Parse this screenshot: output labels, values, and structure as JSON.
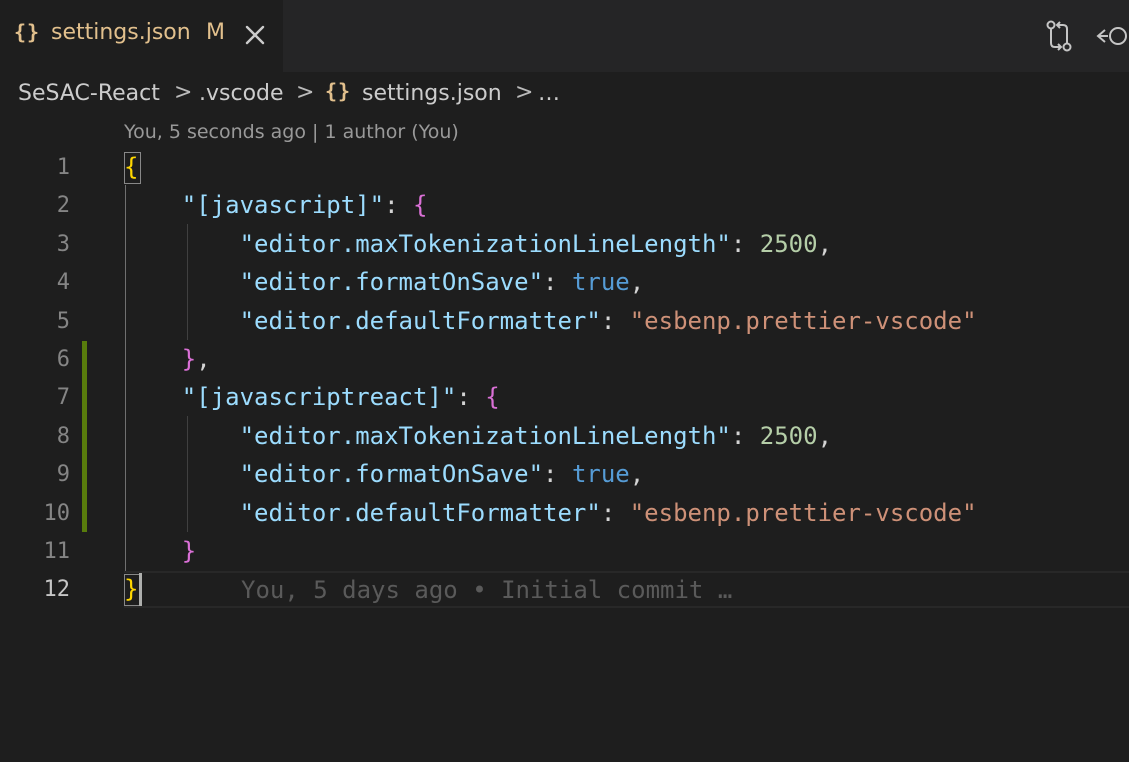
{
  "tab": {
    "icon_text": "{}",
    "label": "settings.json",
    "modified_badge": "M",
    "close_icon": "close-icon"
  },
  "editor_actions": {
    "compare_icon": "git-compare-icon",
    "back_icon": "go-back-icon"
  },
  "breadcrumb": {
    "items": [
      "SeSAC-React",
      ".vscode",
      "settings.json",
      "…"
    ],
    "file_icon_text": "{}",
    "separator": ">"
  },
  "codelens": "You, 5 seconds ago | 1 author (You)",
  "gutter": {
    "line_numbers": [
      "1",
      "2",
      "3",
      "4",
      "5",
      "6",
      "7",
      "8",
      "9",
      "10",
      "11",
      "12"
    ],
    "active_line": "12"
  },
  "code": {
    "lines": [
      {
        "tokens": [
          {
            "c": "y",
            "t": "{"
          }
        ]
      },
      {
        "tokens": [
          {
            "c": "p",
            "t": "    "
          },
          {
            "c": "k",
            "t": "\"[javascript]\""
          },
          {
            "c": "p",
            "t": ": "
          },
          {
            "c": "m",
            "t": "{"
          }
        ]
      },
      {
        "tokens": [
          {
            "c": "p",
            "t": "        "
          },
          {
            "c": "k",
            "t": "\"editor.maxTokenizationLineLength\""
          },
          {
            "c": "p",
            "t": ": "
          },
          {
            "c": "n",
            "t": "2500"
          },
          {
            "c": "p",
            "t": ","
          }
        ]
      },
      {
        "tokens": [
          {
            "c": "p",
            "t": "        "
          },
          {
            "c": "k",
            "t": "\"editor.formatOnSave\""
          },
          {
            "c": "p",
            "t": ": "
          },
          {
            "c": "b",
            "t": "true"
          },
          {
            "c": "p",
            "t": ","
          }
        ]
      },
      {
        "tokens": [
          {
            "c": "p",
            "t": "        "
          },
          {
            "c": "k",
            "t": "\"editor.defaultFormatter\""
          },
          {
            "c": "p",
            "t": ": "
          },
          {
            "c": "s",
            "t": "\"esbenp.prettier-vscode\""
          }
        ]
      },
      {
        "tokens": [
          {
            "c": "p",
            "t": "    "
          },
          {
            "c": "m",
            "t": "}"
          },
          {
            "c": "p",
            "t": ","
          }
        ]
      },
      {
        "tokens": [
          {
            "c": "p",
            "t": "    "
          },
          {
            "c": "k",
            "t": "\"[javascriptreact]\""
          },
          {
            "c": "p",
            "t": ": "
          },
          {
            "c": "m",
            "t": "{"
          }
        ]
      },
      {
        "tokens": [
          {
            "c": "p",
            "t": "        "
          },
          {
            "c": "k",
            "t": "\"editor.maxTokenizationLineLength\""
          },
          {
            "c": "p",
            "t": ": "
          },
          {
            "c": "n",
            "t": "2500"
          },
          {
            "c": "p",
            "t": ","
          }
        ]
      },
      {
        "tokens": [
          {
            "c": "p",
            "t": "        "
          },
          {
            "c": "k",
            "t": "\"editor.formatOnSave\""
          },
          {
            "c": "p",
            "t": ": "
          },
          {
            "c": "b",
            "t": "true"
          },
          {
            "c": "p",
            "t": ","
          }
        ]
      },
      {
        "tokens": [
          {
            "c": "p",
            "t": "        "
          },
          {
            "c": "k",
            "t": "\"editor.defaultFormatter\""
          },
          {
            "c": "p",
            "t": ": "
          },
          {
            "c": "s",
            "t": "\"esbenp.prettier-vscode\""
          }
        ]
      },
      {
        "tokens": [
          {
            "c": "p",
            "t": "    "
          },
          {
            "c": "m",
            "t": "}"
          }
        ]
      },
      {
        "tokens": [
          {
            "c": "y",
            "t": "}"
          }
        ]
      }
    ]
  },
  "inline_blame": "You, 5 days ago • Initial commit …",
  "colors": {
    "background": "#1e1e1e",
    "tab_modified": "#e2c08d",
    "property_key": "#9cdcfe",
    "string_value": "#ce9178",
    "number_value": "#b5cea8",
    "boolean_value": "#569cd6",
    "bracket_level_1": "#ffd700",
    "bracket_level_2": "#da70d6",
    "gutter_modified": "#587c0c"
  }
}
